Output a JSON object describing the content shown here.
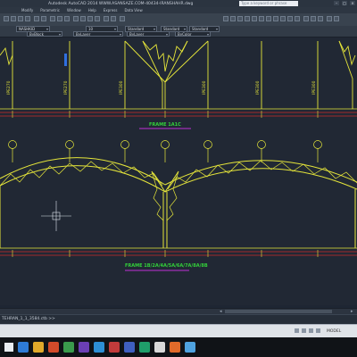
{
  "titlebar": {
    "title": "Autodesk AutoCAD 2014   WWW.ASANSAZE.COM-40434-IRANSHAHR.dwg",
    "search_placeholder": "Type a keyword or phrase"
  },
  "menubar": {
    "items": [
      "Modify",
      "Parametric",
      "Window",
      "Help",
      "Express",
      "Data View"
    ]
  },
  "properties": {
    "layer": "NASHKID",
    "size": "10",
    "textstyle": "Standard",
    "dimstyle": "Standard",
    "tablestyle": "Standard",
    "color": "ByBlock",
    "linetype": "ByLayer",
    "lineweight": "ByLayer",
    "plotstyle": "ByColor"
  },
  "drawing": {
    "frame_upper_title": "FRAME 1A1C",
    "frame_lower_title": "FRAME 1B/2A/4A/5A/6A/7A/8A/8B",
    "column_labels": [
      "IPE270",
      "IPE270",
      "IPE300",
      "IPE300",
      "IPE300",
      "IPE300"
    ],
    "colors": {
      "background": "#212834",
      "truss": "#e6e63a",
      "dims": "#cc2b2b",
      "title": "#33d13a",
      "underline": "#c02fd6"
    }
  },
  "command_line": {
    "text": "TEHRAN_1_1_3584.ctb >>"
  },
  "status": {
    "model_label": "MODEL"
  }
}
